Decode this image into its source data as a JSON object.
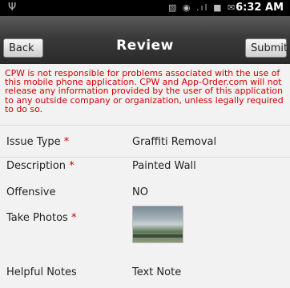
{
  "status_bar": {
    "time": "6:32 AM"
  },
  "header": {
    "title": "Review",
    "back_label": "Back",
    "submit_label": "Submit"
  },
  "disclaimer": "CPW is not responsible for problems associated with the use of this mobile phone application. CPW and App-Order.com will not release any information provided by the user of this application to any outside company or organization, unless legally required to do so.",
  "fields": [
    {
      "label": "Issue Type",
      "required_mark": "*",
      "value": "Graffiti Removal"
    },
    {
      "label": "Description",
      "required_mark": "*",
      "value": "Painted Wall"
    },
    {
      "label": "Offensive",
      "value": "NO"
    },
    {
      "label": "Take Photos",
      "required_mark": "*"
    },
    {
      "label": "Helpful Notes",
      "value": "Text Note"
    }
  ],
  "colors": {
    "required": "#d10000",
    "title_bar": "#3a3a3a"
  }
}
